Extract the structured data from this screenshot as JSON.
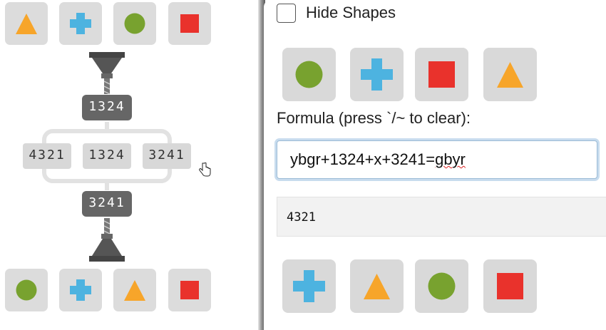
{
  "left_panel": {
    "top_shapes": [
      "triangle-orange",
      "cross-blue",
      "circle-green",
      "square-red"
    ],
    "bottom_shapes": [
      "circle-green",
      "cross-blue",
      "triangle-orange",
      "square-red"
    ],
    "input_code": "1324",
    "branches": [
      "4321",
      "1324",
      "3241"
    ],
    "output_code": "3241"
  },
  "right_panel": {
    "hide_shapes_label": "Hide Shapes",
    "top_buttons": [
      "circle-green",
      "cross-blue",
      "square-red",
      "triangle-orange"
    ],
    "formula_label": "Formula (press `/~ to clear):",
    "formula_value_main": "ybgr+1324+x+3241=",
    "formula_value_flagged": "gbyr",
    "output_value": "4321",
    "bottom_buttons": [
      "cross-blue",
      "triangle-orange",
      "circle-green",
      "square-red"
    ]
  },
  "colors": {
    "green": "#78a22f",
    "blue": "#4db3e0",
    "red": "#e9322c",
    "orange": "#f7a52a",
    "tile_gray": "#dcdcdc"
  }
}
